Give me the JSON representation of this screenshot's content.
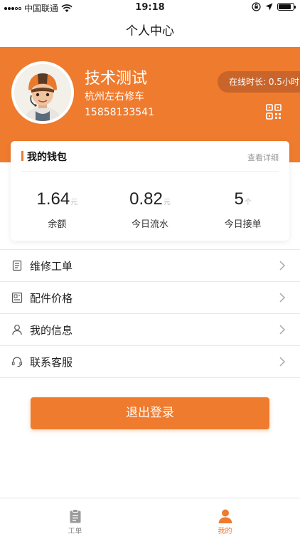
{
  "status_bar": {
    "carrier": "中国联通",
    "time": "19:18"
  },
  "nav": {
    "title": "个人中心"
  },
  "profile": {
    "name": "技术测试",
    "shop": "杭州左右修车",
    "phone": "15858133541",
    "online_time": "在线时长: 0.5小时",
    "avatar_icon": "technician-avatar",
    "qr_icon": "qr-code-icon"
  },
  "wallet": {
    "title": "我的钱包",
    "detail_link": "查看详细",
    "stats": [
      {
        "value": "1.64",
        "unit": "元",
        "label": "余额"
      },
      {
        "value": "0.82",
        "unit": "元",
        "label": "今日流水"
      },
      {
        "value": "5",
        "unit": "个",
        "label": "今日接单"
      }
    ]
  },
  "menu": {
    "items": [
      {
        "label": "维修工单",
        "icon": "order-list-icon"
      },
      {
        "label": "配件价格",
        "icon": "parts-price-icon"
      },
      {
        "label": "我的信息",
        "icon": "user-icon"
      },
      {
        "label": "联系客服",
        "icon": "headset-icon"
      }
    ]
  },
  "logout": {
    "label": "退出登录"
  },
  "tabbar": {
    "tabs": [
      {
        "label": "工单",
        "icon": "clipboard-icon",
        "active": false
      },
      {
        "label": "我的",
        "icon": "person-icon",
        "active": true
      }
    ]
  },
  "colors": {
    "accent": "#ef7b2e",
    "pill": "#c9642a"
  }
}
